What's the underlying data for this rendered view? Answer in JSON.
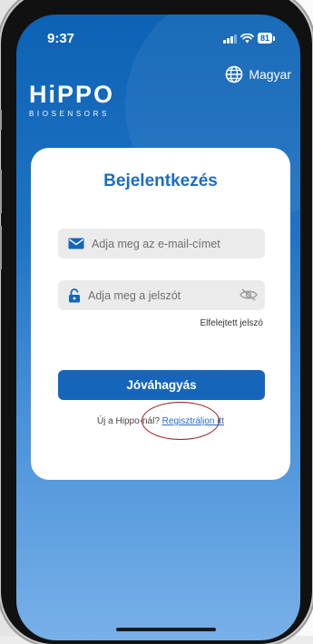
{
  "status_bar": {
    "time": "9:37",
    "battery": "81",
    "icons": [
      "signal-icon",
      "wifi-icon",
      "battery-icon"
    ]
  },
  "language": {
    "label": "Magyar",
    "icon": "globe-icon"
  },
  "logo": {
    "main": "HiPPO",
    "sub": "BIOSENSORS"
  },
  "login": {
    "title": "Bejelentkezés",
    "email_placeholder": "Adja meg az e-mail-címet",
    "password_placeholder": "Adja meg a jelszót",
    "forgot_password": "Elfelejtett jelszó",
    "submit_label": "Jóváhagyás",
    "register_prompt": "Új a Hippo-nál?",
    "register_link": "Regisztráljon itt"
  },
  "colors": {
    "brand_blue": "#1566bb",
    "title_blue": "#1d6cc2",
    "highlight_red": "#9a1c20"
  }
}
